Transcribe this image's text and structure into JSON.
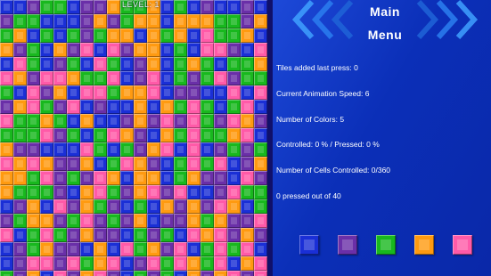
{
  "level_label": "LEVEL: 1",
  "menu": {
    "line1": "Main",
    "line2": "Menu"
  },
  "stats": [
    "Tiles added last press: 0",
    "Current Animation Speed: 6",
    "Number of Colors: 5",
    "Controlled: 0 % / Pressed: 0 %",
    "Number of Cells Controlled: 0/360",
    "0 pressed out of 40"
  ],
  "palette": {
    "blue": "#1a2fd6",
    "purple": "#6a2fa8",
    "green": "#18b81e",
    "orange": "#ff9a10",
    "pink": "#ff5aa8"
  },
  "color_buttons": [
    {
      "name": "blue",
      "color": "#1a2fd6"
    },
    {
      "name": "purple",
      "color": "#6a2fa8"
    },
    {
      "name": "green",
      "color": "#18b81e"
    },
    {
      "name": "orange",
      "color": "#ff9a10"
    },
    {
      "name": "pink",
      "color": "#ff5aa8"
    }
  ],
  "grid": {
    "cols": 20,
    "rows": 20,
    "cells": [
      "BBPGGBPPOGGOBGBPBBPB",
      "PGGBBBPOPGOOBOOOGGPO",
      "GOBGBGPGOOBOGOBKGGOB",
      "OPGBOPKBKPOOBGBKKPBK",
      "BKGBPGBKGBPOBGOGBGGO",
      "KOPKKOGGKBPKBGPGKPGG",
      "GBKPOBKKGOOKBPPBBKBK",
      "POKGPKBPBBOBOGKGBGKB",
      "KGGOGBOBBPOPKPKGPKOP",
      "GGGKPGBGKOPBOGKGGOKB",
      "OPPBBBKGBGPOKBKBPGPG",
      "KOKOPPOBGKOPBGKGKBPO",
      "OOGKPGPKOBOOBGOPPBKP",
      "OGGGPBOKGPOKPKBBPKGG",
      "BPOBKPOGPBGBOPOPKOBG",
      "PGOOPGKPGPOBPPOGOPPK",
      "KBGKGPOPPBGPGBKOKPOP",
      "BPGOPPBOBKGOPKBGKGKB",
      "BPKKPKGOKBPKGKOGKBOK",
      "GPOBKPOKPBGPGBOPOKPK"
    ]
  }
}
